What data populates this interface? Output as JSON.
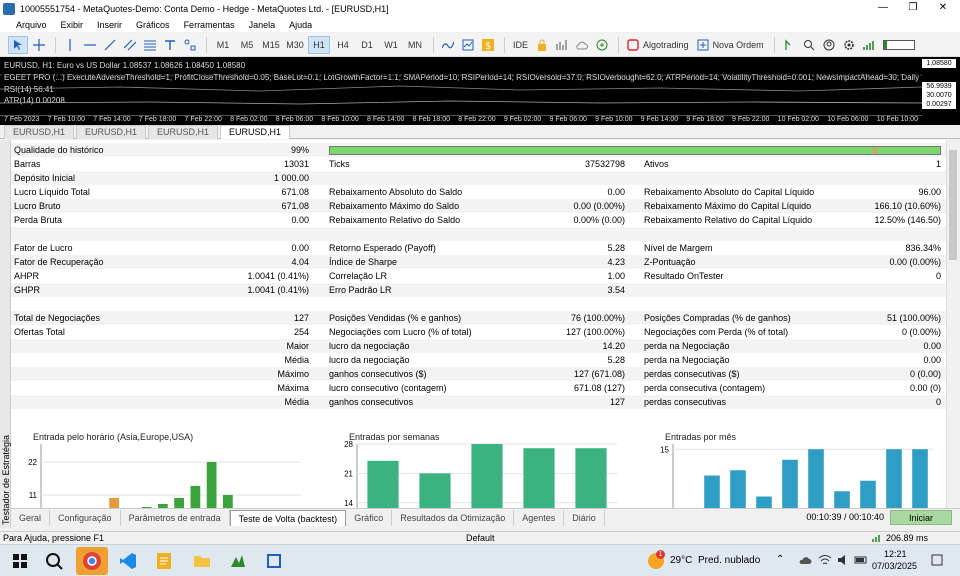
{
  "window": {
    "title": "10005551754 - MetaQuotes-Demo: Conta Demo - Hedge - MetaQuotes Ltd. - [EURUSD,H1]",
    "controls": [
      "—",
      "❐",
      "✕"
    ]
  },
  "menu": [
    "Arquivo",
    "Exibir",
    "Inserir",
    "Gráficos",
    "Ferramentas",
    "Janela",
    "Ajuda"
  ],
  "toolbar": {
    "timeframes": [
      "M1",
      "M5",
      "M15",
      "M30",
      "H1",
      "H4",
      "D1",
      "W1",
      "MN"
    ],
    "active_timeframe": "H1",
    "ide_label": "IDE",
    "algotrading_label": "Algotrading",
    "new_order_label": "Nova Ordem"
  },
  "chart": {
    "header": "EURUSD, H1:  Euro vs US Dollar  1.08537 1.08626 1.08450 1.08580",
    "ea_line": "EGEET PRO (...) ExecuteAdverseThreshold=1; ProfitCloseThreshold=0.05; BaseLot=0.1; LotGrowthFactor=1.1; SMAPeriod=10; RSIPeriod=14; RSIOversold=37.0; RSIOverbought=62.0; ATRPeriod=14; VolatilityThreshold=0.001; NewsImpactAhead=30; DailyMaxLoss=...",
    "rsi_label": "RSI(14) 56.41",
    "atr_label": "ATR(14) 0.00208",
    "price_boxes": [
      "1.08580",
      "56.9939",
      "30.0070",
      "0.00297"
    ],
    "time_axis": [
      "7 Feb 2023",
      "7 Feb 10:00",
      "7 Feb 14:00",
      "7 Feb 18:00",
      "7 Feb 22:00",
      "8 Feb 02:00",
      "8 Feb 06:00",
      "8 Feb 10:00",
      "8 Feb 14:00",
      "8 Feb 18:00",
      "8 Feb 22:00",
      "9 Feb 02:00",
      "9 Feb 06:00",
      "9 Feb 10:00",
      "9 Feb 14:00",
      "9 Feb 18:00",
      "9 Feb 22:00",
      "10 Feb 02:00",
      "10 Feb 06:00",
      "10 Feb 10:00"
    ]
  },
  "chart_tabs": [
    "EURUSD,H1",
    "EURUSD,H1",
    "EURUSD,H1",
    "EURUSD,H1"
  ],
  "active_chart_tab": 3,
  "report": {
    "quality_label": "Qualidade do histórico",
    "quality_value": "99%",
    "quality_fraction": 0.99,
    "rows": [
      [
        "Barras",
        "13031",
        "Ticks",
        "37532798",
        "Ativos",
        "1"
      ],
      [
        "Depósito Inicial",
        "1 000.00",
        "",
        "",
        "",
        ""
      ],
      [
        "Lucro Líquido Total",
        "671.08",
        "Rebaixamento Absoluto do Saldo",
        "0.00",
        "Rebaixamento Absoluto do Capital Líquido",
        "96.00"
      ],
      [
        "Lucro Bruto",
        "671.08",
        "Rebaixamento Máximo do Saldo",
        "0.00 (0.00%)",
        "Rebaixamento Máximo do Capital Líquido",
        "166.10 (10.60%)"
      ],
      [
        "Perda Bruta",
        "0.00",
        "Rebaixamento Relativo do Saldo",
        "0.00% (0.00)",
        "Rebaixamento Relativo do Capital Líquido",
        "12.50% (146.50)"
      ],
      [
        "",
        "",
        "",
        "",
        "",
        ""
      ],
      [
        "Fator de Lucro",
        "0.00",
        "Retorno Esperado (Payoff)",
        "5.28",
        "Nível de Margem",
        "836.34%"
      ],
      [
        "Fator de Recuperação",
        "4.04",
        "Índice de Sharpe",
        "4.23",
        "Z-Pontuação",
        "0.00 (0.00%)"
      ],
      [
        "AHPR",
        "1.0041 (0.41%)",
        "Correlação LR",
        "1.00",
        "Resultado OnTester",
        "0"
      ],
      [
        "GHPR",
        "1.0041 (0.41%)",
        "Erro Padrão LR",
        "3.54",
        "",
        ""
      ],
      [
        "",
        "",
        "",
        "",
        "",
        ""
      ],
      [
        "Total de Negociações",
        "127",
        "Posições Vendidas (% e ganhos)",
        "76 (100.00%)",
        "Posições Compradas (% de ganhos)",
        "51 (100.00%)"
      ],
      [
        "Ofertas Total",
        "254",
        "Negociações com Lucro (% of total)",
        "127 (100.00%)",
        "Negociações com Perda (% of total)",
        "0 (0.00%)"
      ],
      [
        "Maior",
        "",
        "lucro da negociação",
        "14.20",
        "perda na Negociação",
        "0.00"
      ],
      [
        "Média",
        "",
        "lucro da negociação",
        "5.28",
        "perda na Negociação",
        "0.00"
      ],
      [
        "Máximo",
        "",
        "ganhos consecutivos ($)",
        "127 (671.08)",
        "perdas consecutivas ($)",
        "0 (0.00)"
      ],
      [
        "Máxima",
        "",
        "lucro consecutivo (contagem)",
        "671.08 (127)",
        "perda consecutiva (contagem)",
        "0.00 (0)"
      ],
      [
        "Média",
        "",
        "ganhos consecutivos",
        "127",
        "perdas consecutivas",
        "0"
      ]
    ]
  },
  "chart_data": [
    {
      "type": "bar",
      "title": "Entrada pelo horário (Asia,Europe,USA)",
      "yticks": [
        "22",
        "11"
      ],
      "ylim": [
        0,
        28
      ],
      "series": [
        {
          "color": "#e39a3b",
          "values": [
            0,
            0,
            0,
            0,
            10,
            0,
            0,
            0,
            0,
            0,
            0,
            0,
            0,
            0,
            0,
            0
          ]
        },
        {
          "color": "#3ba33b",
          "values": [
            0,
            0,
            0,
            0,
            0,
            0,
            7,
            8,
            10,
            14,
            22,
            11,
            0,
            0,
            0,
            0
          ]
        }
      ]
    },
    {
      "type": "bar",
      "title": "Entradas por semanas",
      "yticks": [
        "28",
        "21",
        "14"
      ],
      "ylim": [
        8,
        28
      ],
      "series": [
        {
          "color": "#3bb380",
          "values": [
            24,
            21,
            28,
            27,
            27
          ]
        }
      ]
    },
    {
      "type": "bar",
      "title": "Entradas por mês",
      "yticks": [
        "15"
      ],
      "ylim": [
        0,
        16
      ],
      "series": [
        {
          "color": "#2f9ec4",
          "values": [
            2,
            10,
            11,
            6,
            13,
            15,
            7,
            9,
            15,
            15
          ]
        }
      ]
    }
  ],
  "bottom_tabs": [
    "Geral",
    "Configuração",
    "Parâmetros de entrada",
    "Teste de Volta (backtest)",
    "Gráfico",
    "Resultados da Otimização",
    "Agentes",
    "Diário"
  ],
  "active_bottom_tab": 3,
  "tester": {
    "side_label": "Testador de Estratégia",
    "timer": "00:10:39 / 00:10:40",
    "start_label": "Iniciar"
  },
  "status": {
    "help": "Para Ajuda, pressione F1",
    "profile": "Default",
    "ping": "206.89 ms"
  },
  "taskbar": {
    "weather_temp": "29°C",
    "weather_desc": "Pred. nublado",
    "time": "12:21",
    "date": "07/03/2025",
    "notification_count": "1"
  }
}
